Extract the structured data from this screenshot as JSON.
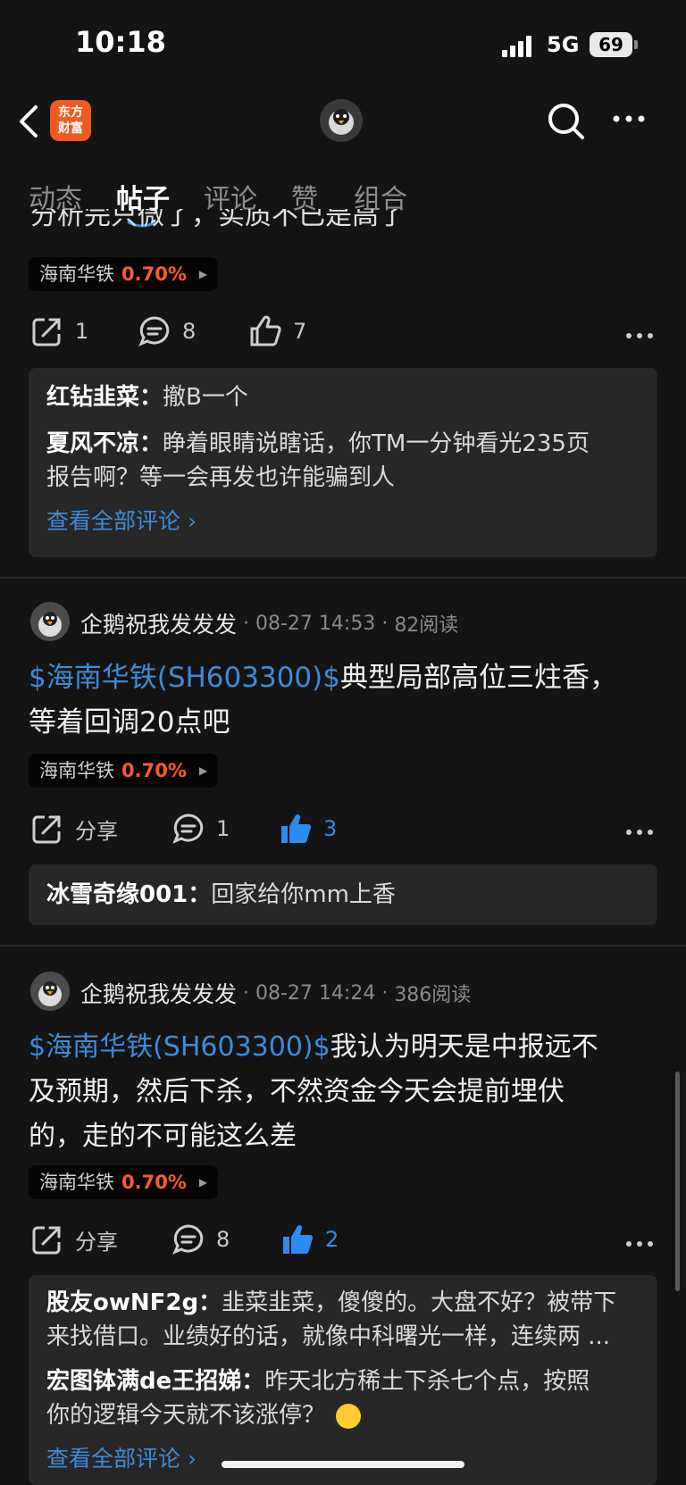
{
  "status_bar": {
    "time": "10:18",
    "network": "5G",
    "battery": "69"
  },
  "nav": {
    "logo_line1": "东方",
    "logo_line2": "财富"
  },
  "tabs": [
    {
      "label": "动态",
      "active": false
    },
    {
      "label": "帖子",
      "active": true
    },
    {
      "label": "评论",
      "active": false
    },
    {
      "label": "赞",
      "active": false
    },
    {
      "label": "组合",
      "active": false
    }
  ],
  "posts": [
    {
      "partial_text": "分析完只微了，实质不已是高了",
      "stock_tag": {
        "name": "海南华铁",
        "change": "0.70%"
      },
      "actions": {
        "share": "1",
        "comment": "8",
        "like": "7"
      },
      "comments": [
        {
          "user": "红钻韭菜：",
          "text": "撤B一个"
        },
        {
          "user": "夏风不凉：",
          "text": "睁着眼睛说瞎话，你TM一分钟看光235页",
          "text2": "报告啊？等一会再发也许能骗到人"
        }
      ],
      "see_all": "查看全部评论"
    },
    {
      "author": "企鹅祝我发发发",
      "date": "08-27 14:53",
      "reads": "82阅读",
      "stock_link": "$海南华铁(SH603300)$",
      "body_line1": "典型局部高位三炷香，",
      "body_line2": "等着回调20点吧",
      "stock_tag": {
        "name": "海南华铁",
        "change": "0.70%"
      },
      "actions": {
        "share": "分享",
        "comment": "1",
        "like": "3"
      },
      "comments": [
        {
          "user": "冰雪奇缘001：",
          "text": "回家给你mm上香"
        }
      ]
    },
    {
      "author": "企鹅祝我发发发",
      "date": "08-27 14:24",
      "reads": "386阅读",
      "stock_link": "$海南华铁(SH603300)$",
      "body_line1": "我认为明天是中报远不",
      "body_line2": "及预期，然后下杀，不然资金今天会提前埋伏",
      "body_line3": "的，走的不可能这么差",
      "stock_tag": {
        "name": "海南华铁",
        "change": "0.70%"
      },
      "actions": {
        "share": "分享",
        "comment": "8",
        "like": "2"
      },
      "comments": [
        {
          "user": "股友owNF2g：",
          "text": "韭菜韭菜，傻傻的。大盘不好？被带下",
          "text2": "来找借口。业绩好的话，就像中科曙光一样，连续两 ..."
        },
        {
          "user": "宏图钵满de王招娣：",
          "text": "昨天北方稀土下杀七个点，按照",
          "text2": "你的逻辑今天就不该涨停？"
        }
      ],
      "see_all": "查看全部评论"
    }
  ],
  "colors": {
    "accent_blue": "#3f8ad8",
    "up_red": "#ff5a2a",
    "logo_orange": "#ef5a23"
  }
}
